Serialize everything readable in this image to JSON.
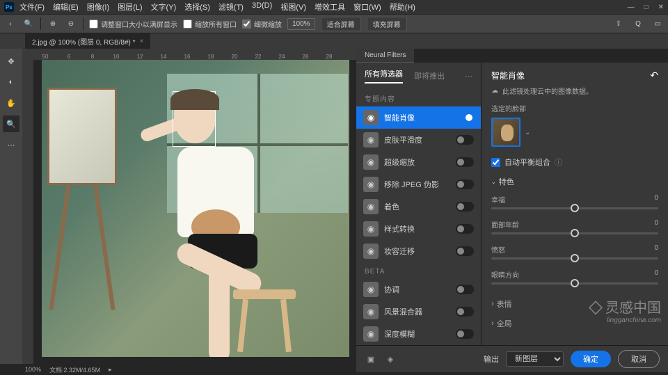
{
  "menubar": [
    "文件(F)",
    "编辑(E)",
    "图像(I)",
    "图层(L)",
    "文字(Y)",
    "选择(S)",
    "滤镜(T)",
    "3D(D)",
    "视图(V)",
    "增效工具",
    "窗口(W)",
    "帮助(H)"
  ],
  "winctl": [
    "—",
    "□",
    "✕"
  ],
  "optbar": {
    "resize_to_fullscreen": "调整窗口大小以满屏显示",
    "zoom_all": "缩放所有窗口",
    "scrubby": "细微缩放",
    "zoom_pct": "100%",
    "fit": "适合屏幕",
    "fill": "填充屏幕"
  },
  "tab": {
    "label": "2.jpg @ 100% (图层 0, RGB/8#) *"
  },
  "ruler": [
    "50",
    "6",
    "8",
    "10",
    "12",
    "14",
    "16",
    "18",
    "20",
    "22",
    "24",
    "26",
    "28"
  ],
  "nf_panel_tab": "Neural Filters",
  "filter_tabs": {
    "all": "所有筛选器",
    "wait": "即将推出"
  },
  "sections": {
    "featured": "专题内容",
    "beta": "BETA"
  },
  "filters": {
    "featured": [
      {
        "name": "智能肖像",
        "on": true,
        "active": true
      },
      {
        "name": "皮肤平滑度",
        "on": false
      },
      {
        "name": "超级缩放",
        "on": false
      },
      {
        "name": "移除 JPEG 伪影",
        "on": false
      },
      {
        "name": "着色",
        "on": false
      },
      {
        "name": "样式转换",
        "on": false
      },
      {
        "name": "妆容迁移",
        "on": false
      }
    ],
    "beta": [
      {
        "name": "协调",
        "on": false
      },
      {
        "name": "风景混合器",
        "on": false
      },
      {
        "name": "深度模糊",
        "on": false
      }
    ]
  },
  "settings": {
    "title": "智能肖像",
    "cloud_msg": "此滤镜处理云中的图像数据。",
    "face_label": "选定的脸部",
    "auto_balance": "自动平衡组合",
    "group_feature": "特色",
    "sliders": [
      {
        "label": "幸福",
        "value": "0"
      },
      {
        "label": "面部年龄",
        "value": "0"
      },
      {
        "label": "愤怒",
        "value": "0"
      },
      {
        "label": "眼睛方向",
        "value": "0"
      }
    ],
    "collapsed": [
      "表情",
      "全局"
    ]
  },
  "bottom": {
    "output_label": "输出",
    "output_value": "新图层",
    "ok": "确定",
    "cancel": "取消"
  },
  "status": {
    "zoom": "100%",
    "doc": "文档:2.32M/4.65M"
  },
  "watermark": {
    "main": "灵感中国",
    "sub": "lingganchina.com"
  }
}
